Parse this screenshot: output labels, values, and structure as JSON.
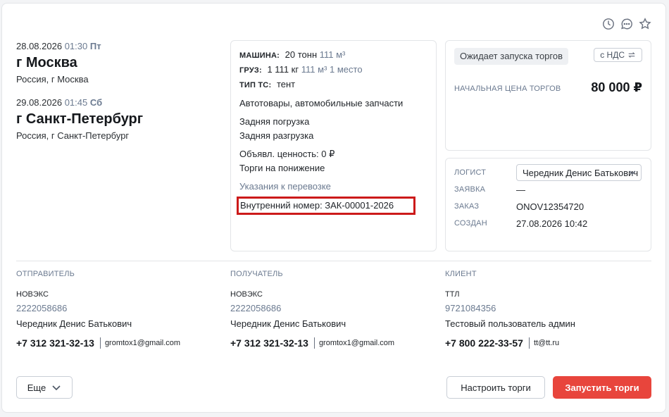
{
  "header_icons": [
    "clock-icon",
    "comment-icon",
    "star-icon"
  ],
  "route": {
    "origin": {
      "date": "28.08.2026",
      "time": "01:30",
      "weekday": "Пт",
      "city": "г Москва",
      "address": "Россия, г Москва"
    },
    "destination": {
      "date": "29.08.2026",
      "time": "01:45",
      "weekday": "Сб",
      "city": "г Санкт-Петербург",
      "address": "Россия, г Санкт-Петербург"
    }
  },
  "cargo": {
    "vehicle_label": "МАШИНА:",
    "vehicle_weight": "20 тонн",
    "vehicle_volume": "111 м³",
    "cargo_label": "ГРУЗ:",
    "cargo_weight": "1 111 кг",
    "cargo_volume": "111 м³",
    "cargo_places": "1 место",
    "ts_type_label": "ТИП ТС:",
    "ts_type": "тент",
    "goods": "Автотовары, автомобильные запчасти",
    "loading": "Задняя погрузка",
    "unloading": "Задняя разгрузка",
    "declared_value": "Объявл. ценность: 0 ₽",
    "trade_type": "Торги на понижение",
    "instructions_link": "Указания к перевозке",
    "internal_number": "Внутренний номер: ЗАК-00001-2026"
  },
  "trade": {
    "status": "Ожидает запуска торгов",
    "nds_button": "с НДС",
    "start_price_label": "НАЧАЛЬНАЯ ЦЕНА ТОРГОВ",
    "start_price": "80 000 ₽"
  },
  "meta": {
    "logist_label": "ЛОГИСТ",
    "logist_value": "Чередник Денис Батькович",
    "request_label": "ЗАЯВКА",
    "request_value": "—",
    "order_label": "ЗАКАЗ",
    "order_value": "ONOV12354720",
    "created_label": "СОЗДАН",
    "created_value": "27.08.2026 10:42"
  },
  "parties": {
    "sender": {
      "title": "ОТПРАВИТЕЛЬ",
      "company": "НОВЭКС",
      "inn": "2222058686",
      "person": "Чередник Денис Батькович",
      "phone": "+7 312 321-32-13",
      "email": "gromtox1@gmail.com"
    },
    "receiver": {
      "title": "ПОЛУЧАТЕЛЬ",
      "company": "НОВЭКС",
      "inn": "2222058686",
      "person": "Чередник Денис Батькович",
      "phone": "+7 312 321-32-13",
      "email": "gromtox1@gmail.com"
    },
    "client": {
      "title": "КЛИЕНТ",
      "company": "ТТЛ",
      "inn": "9721084356",
      "person": "Тестовый пользователь админ",
      "phone": "+7 800 222-33-57",
      "email": "tt@tt.ru"
    }
  },
  "buttons": {
    "more": "Еще",
    "setup_trade": "Настроить торги",
    "start_trade": "Запустить торги"
  },
  "colors": {
    "accent_red": "#e8453c",
    "highlight_border": "#cc1a1a",
    "muted_text": "#6b7a90"
  }
}
